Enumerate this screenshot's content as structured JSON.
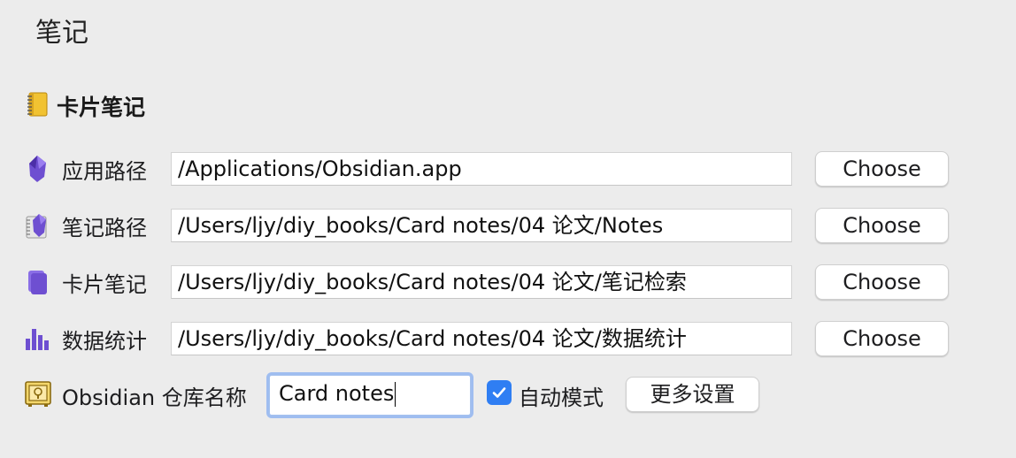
{
  "page": {
    "title": "笔记"
  },
  "section": {
    "title": "卡片笔记",
    "icon": "notebook-icon"
  },
  "rows": [
    {
      "icon": "obsidian-app-icon",
      "label": "应用路径",
      "value": "/Applications/Obsidian.app",
      "button": "Choose"
    },
    {
      "icon": "notes-folder-icon",
      "label": "笔记路径",
      "value": "/Users/ljy/diy_books/Card notes/04 论文/Notes",
      "button": "Choose"
    },
    {
      "icon": "card-stack-icon",
      "label": "卡片笔记",
      "value": "/Users/ljy/diy_books/Card notes/04 论文/笔记检索",
      "button": "Choose"
    },
    {
      "icon": "bar-chart-icon",
      "label": "数据统计",
      "value": "/Users/ljy/diy_books/Card notes/04 论文/数据统计",
      "button": "Choose"
    }
  ],
  "vault": {
    "icon": "safe-icon",
    "label": "Obsidian 仓库名称",
    "value": "Card notes",
    "auto_mode_label": "自动模式",
    "auto_mode_checked": true,
    "more_settings_label": "更多设置"
  },
  "colors": {
    "accent": "#2f7ef3",
    "obsidian_purple": "#6e4fd1",
    "background": "#ececec"
  }
}
